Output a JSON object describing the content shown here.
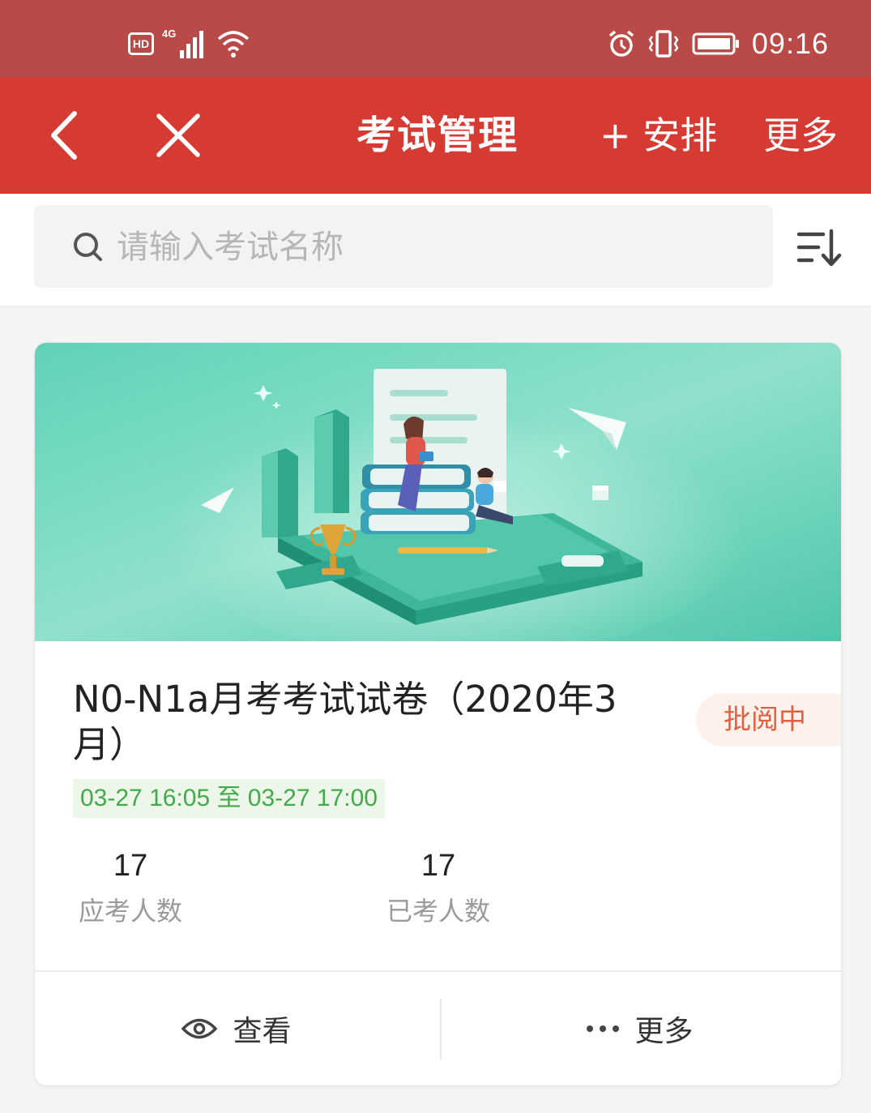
{
  "status_bar": {
    "network_badge": "HD",
    "network_type": "4G",
    "time": "09:16",
    "icons": [
      "hd-icon",
      "signal-icon",
      "wifi-icon",
      "alarm-icon",
      "vibrate-icon",
      "battery-icon"
    ]
  },
  "app_bar": {
    "title": "考试管理",
    "arrange_label": "+ 安排",
    "more_label": "更多",
    "icons": [
      "back-arrow-icon",
      "close-icon"
    ]
  },
  "search": {
    "placeholder": "请输入考试名称",
    "value": "",
    "icons": [
      "search-icon",
      "sort-icon"
    ]
  },
  "exam_card": {
    "title": "N0-N1a月考考试试卷（2020年3月）",
    "status": "批阅中",
    "time_range": "03-27 16:05 至 03-27 17:00",
    "stats": {
      "expected": {
        "value": "17",
        "label": "应考人数"
      },
      "taken": {
        "value": "17",
        "label": "已考人数"
      }
    },
    "actions": {
      "view_label": "查看",
      "more_label": "更多"
    }
  },
  "colors": {
    "status_bar_bg": "#b94a47",
    "app_bar_bg": "#d53a33",
    "banner_bg": "#5ecfb6",
    "status_badge_text": "#e2603f",
    "time_range_text": "#45a84c"
  }
}
